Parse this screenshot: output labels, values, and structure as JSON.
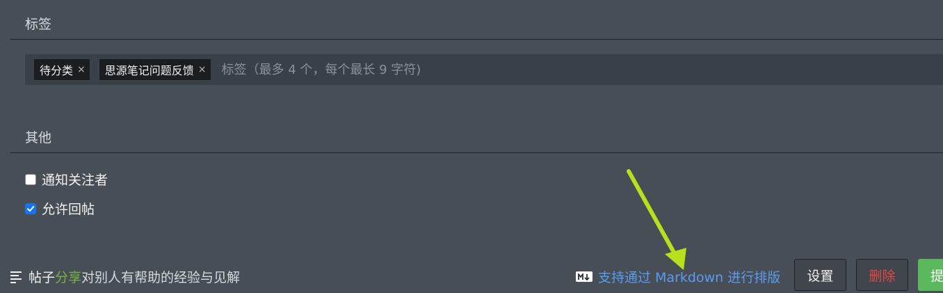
{
  "sections": {
    "tags_title": "标签",
    "other_title": "其他"
  },
  "tags": {
    "items": [
      {
        "label": "待分类",
        "remove": "×"
      },
      {
        "label": "思源笔记问题反馈",
        "remove": "×"
      }
    ],
    "placeholder": "标签（最多 4 个，每个最长 9 字符)"
  },
  "options": {
    "notify_followers": {
      "label": "通知关注者",
      "checked": false
    },
    "allow_reply": {
      "label": "允许回帖",
      "checked": true
    }
  },
  "footer": {
    "icon": "list-icon",
    "label": "帖子",
    "highlight": "分享",
    "description": "对别人有帮助的经验与见解",
    "markdown_badge": "M↓",
    "markdown_link": "支持通过 Markdown 进行排版",
    "settings_button": "设置",
    "delete_button": "删除",
    "submit_button": "提"
  },
  "colors": {
    "background": "#474e55",
    "accent_green": "#78b348",
    "link_blue": "#5b9bf0",
    "danger_red": "#e0484a",
    "submit_green": "#5cb85c",
    "annotation_arrow": "#b7e01e"
  }
}
